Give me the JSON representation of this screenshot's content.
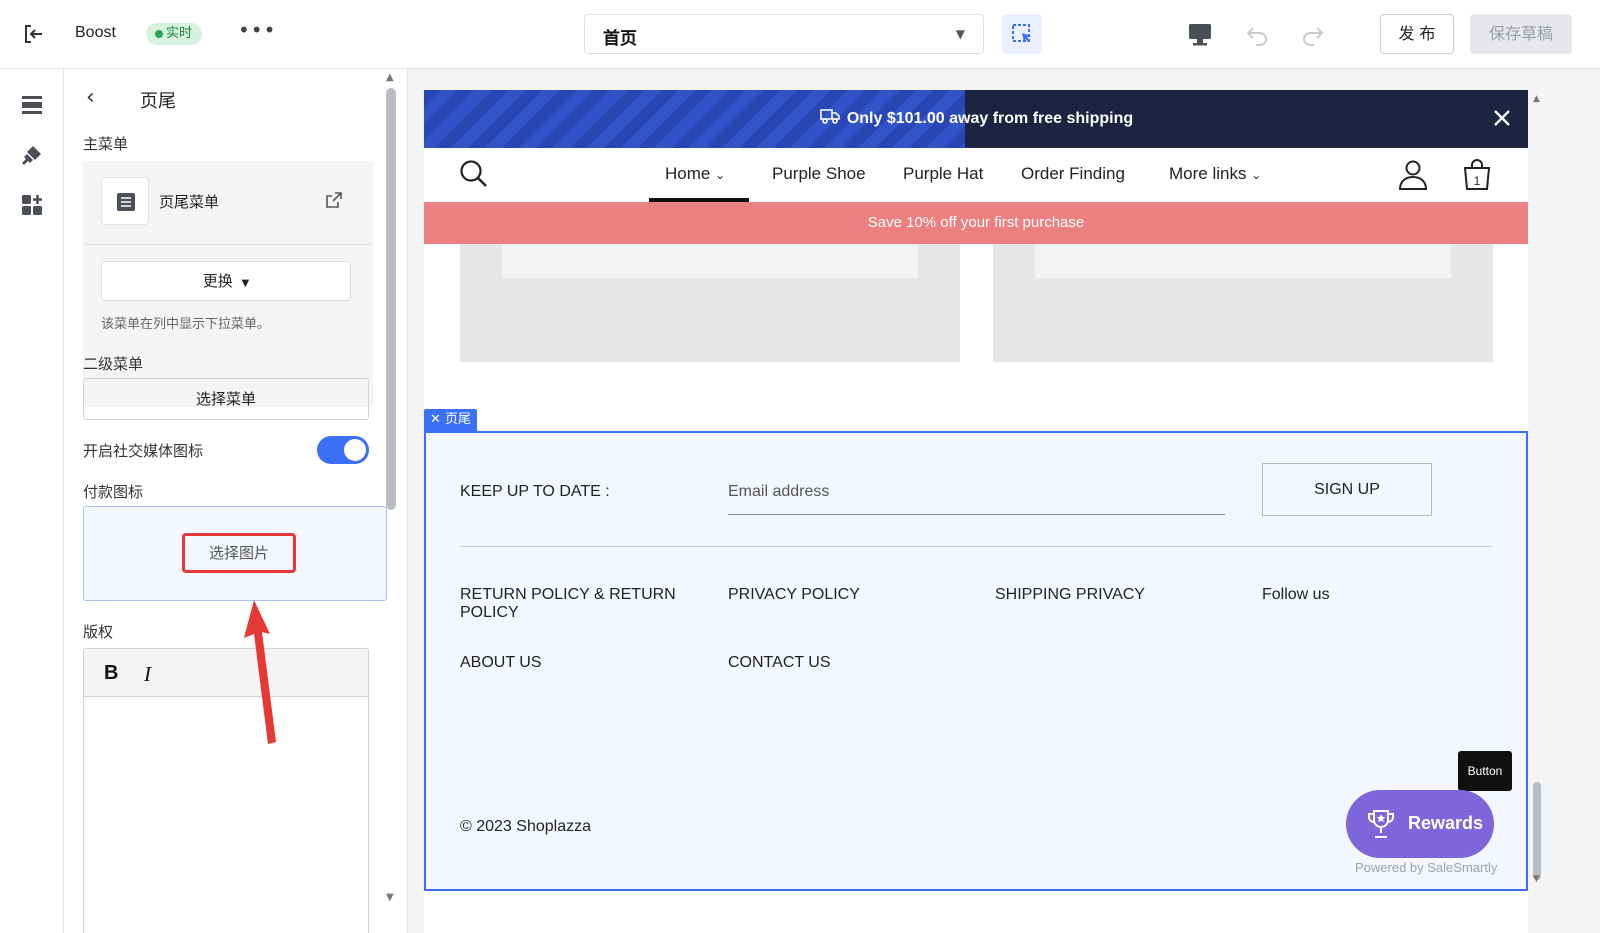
{
  "topbar": {
    "store_name": "Boost",
    "status_badge": "实时",
    "more": "•••",
    "page_selector": "首页",
    "publish": "发 布",
    "save_draft": "保存草稿"
  },
  "rail": {
    "icons": [
      "sections-icon",
      "theme-brush-icon",
      "apps-icon"
    ]
  },
  "panel": {
    "title": "页尾",
    "main_menu_label": "主菜单",
    "main_menu_name": "页尾菜单",
    "change_button": "更换",
    "main_menu_hint": "该菜单在列中显示下拉菜单。",
    "secondary_menu_label": "二级菜单",
    "select_menu_button": "选择菜单",
    "social_toggle_label": "开启社交媒体图标",
    "social_toggle_on": true,
    "payment_icons_label": "付款图标",
    "select_image_button": "选择图片",
    "copyright_label": "版权",
    "rte_bold": "B",
    "rte_italic": "I"
  },
  "preview": {
    "shipping_text": "Only $101.00 away from free shipping",
    "shipping_progress": 0.49,
    "nav": {
      "items": [
        "Home",
        "Purple Shoe",
        "Purple Hat",
        "Order Finding",
        "More links"
      ],
      "active": "Home",
      "cart_count": "1"
    },
    "promo_text": "Save 10% off your first purchase",
    "footer_tag": "页尾",
    "footer": {
      "newsletter_label": "KEEP UP TO DATE :",
      "email_placeholder": "Email address",
      "signup_button": "SIGN UP",
      "links": [
        "RETURN POLICY & RETURN POLICY",
        "PRIVACY POLICY",
        "SHIPPING PRIVACY",
        "Follow us",
        "ABOUT US",
        "CONTACT US"
      ],
      "copyright": "© 2023 Shoplazza"
    },
    "widget": {
      "tooltip": "Button",
      "rewards": "Rewards",
      "powered_by": "Powered by SaleSmartly"
    }
  },
  "colors": {
    "accent": "#3b6ff5",
    "announcement_bg": "#1d2440",
    "promo_bg": "#ec8080",
    "rewards_bg": "#7c66d9",
    "highlight": "#e53935"
  }
}
